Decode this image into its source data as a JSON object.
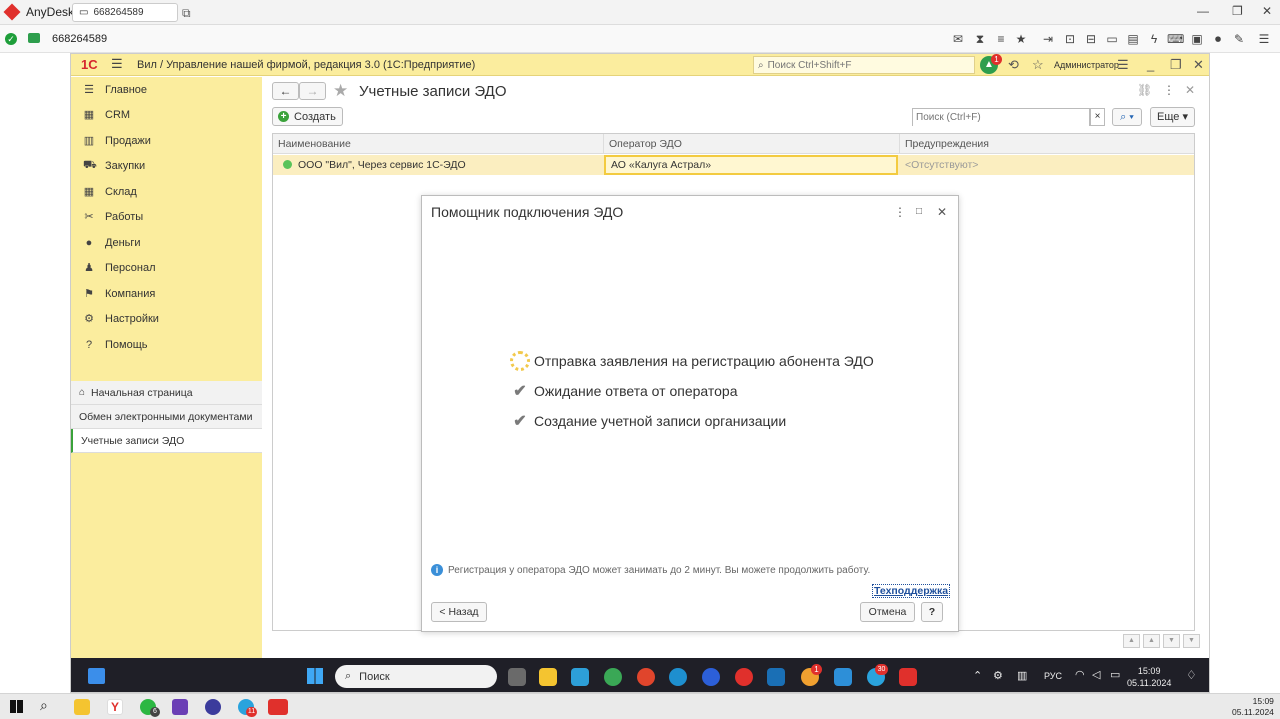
{
  "anydesk": {
    "app_name": "AnyDesk",
    "tab_id": "668264589",
    "session_id": "668264589"
  },
  "header": {
    "logo": "1С",
    "title": "Вил / Управление нашей фирмой, редакция 3.0  (1С:Предприятие)",
    "search_placeholder": "Поиск Ctrl+Shift+F",
    "notifications_count": "1",
    "user": "Администратор"
  },
  "sidebar": {
    "items": [
      {
        "label": "Главное",
        "icon": "menu-icon"
      },
      {
        "label": "CRM",
        "icon": "crm-icon"
      },
      {
        "label": "Продажи",
        "icon": "basket-icon"
      },
      {
        "label": "Закупки",
        "icon": "cart-icon"
      },
      {
        "label": "Склад",
        "icon": "warehouse-icon"
      },
      {
        "label": "Работы",
        "icon": "tools-icon"
      },
      {
        "label": "Деньги",
        "icon": "money-icon"
      },
      {
        "label": "Персонал",
        "icon": "people-icon"
      },
      {
        "label": "Компания",
        "icon": "flag-icon"
      },
      {
        "label": "Настройки",
        "icon": "gear-icon"
      },
      {
        "label": "Помощь",
        "icon": "help-icon"
      }
    ],
    "opened": [
      {
        "label": "Начальная страница"
      },
      {
        "label": "Обмен электронными документами"
      },
      {
        "label": "Учетные записи ЭДО"
      }
    ]
  },
  "form": {
    "title": "Учетные записи ЭДО",
    "create_label": "Создать",
    "search_placeholder": "Поиск (Ctrl+F)",
    "search_clear": "×",
    "more_label": "Еще",
    "columns": [
      "Наименование",
      "Оператор ЭДО",
      "Предупреждения"
    ],
    "rows": [
      [
        "ООО \"Вил\", Через сервис 1С-ЭДО",
        "АО «Калуга Астрал»",
        "<Отсутствуют>"
      ]
    ]
  },
  "dialog": {
    "title": "Помощник подключения ЭДО",
    "steps": [
      {
        "label": "Отправка заявления на регистрацию абонента ЭДО",
        "state": "in-progress"
      },
      {
        "label": "Ожидание ответа от оператора",
        "state": "pending"
      },
      {
        "label": "Создание учетной записи организации",
        "state": "pending"
      }
    ],
    "info": "Регистрация у оператора ЭДО может занимать до 2 минут. Вы можете продолжить работу.",
    "support_link": "Техподдержка",
    "back_label": "< Назад",
    "cancel_label": "Отмена",
    "help_label": "?"
  },
  "remote_taskbar": {
    "search_label": "Поиск",
    "lang": "РУС",
    "time": "15:09",
    "date": "05.11.2024",
    "badge_yandex": "1",
    "badge_telegram": "30"
  },
  "local_taskbar": {
    "time": "15:09",
    "date": "05.11.2024",
    "badge_whatsapp": "6",
    "badge_telegram": "11"
  },
  "colors": {
    "yellow_1c": "#fbed9e",
    "green": "#3aa23a",
    "red": "#e0302c",
    "selection": "#fbeec0"
  }
}
